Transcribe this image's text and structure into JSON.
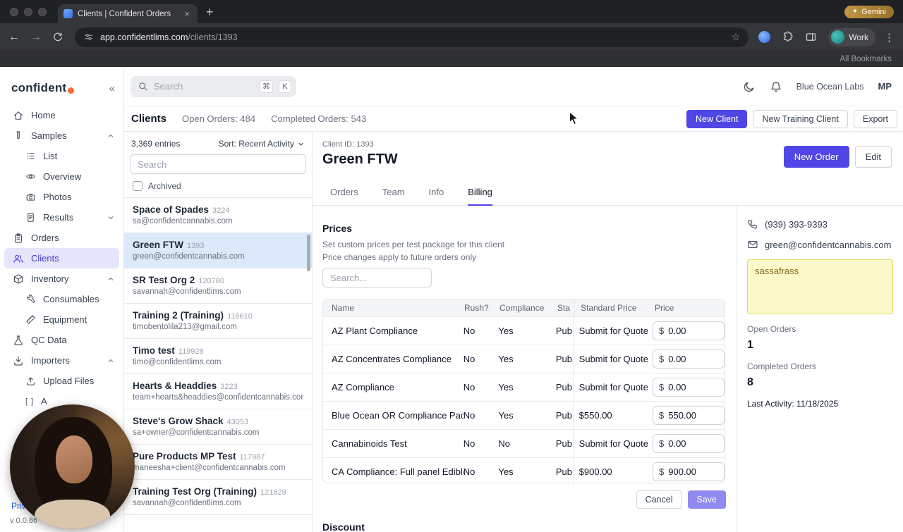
{
  "icons": {
    "back": "←",
    "forward": "→",
    "star": "☆",
    "menu": "⋮",
    "new_tab": "+",
    "close_tab": "×",
    "gemini_sparkle": "✦",
    "collapse": "«",
    "brackets": "[ ]"
  },
  "browser": {
    "tab_title": "Clients | Confident Orders",
    "gemini_label": "Gemini",
    "url_host": "app.confidentlims.com",
    "url_path": "/clients/1393",
    "profile_name": "Work",
    "all_bookmarks": "All Bookmarks"
  },
  "sidebar": {
    "logo_text": "confident",
    "nav": {
      "home": "Home",
      "samples": "Samples",
      "list": "List",
      "overview": "Overview",
      "photos": "Photos",
      "results": "Results",
      "orders": "Orders",
      "clients": "Clients",
      "inventory": "Inventory",
      "consumables": "Consumables",
      "equipment": "Equipment",
      "qc_data": "QC Data",
      "importers": "Importers",
      "upload_files": "Upload Files",
      "api": "A"
    },
    "privacy_link": "Priv",
    "version": "v 0.0.86"
  },
  "topbar": {
    "search_placeholder": "Search",
    "shortcut_cmd": "⌘",
    "shortcut_key": "K",
    "org_name": "Blue Ocean Labs",
    "user_initials": "MP"
  },
  "page_header": {
    "title": "Clients",
    "open_orders": "Open Orders: 484",
    "completed_orders": "Completed Orders: 543",
    "new_client_button": "New Client",
    "new_training_client_button": "New Training Client",
    "export_button": "Export"
  },
  "client_list": {
    "entries_count": "3,369 entries",
    "sort_label": "Sort: Recent Activity",
    "search_placeholder": "Search",
    "archived_label": "Archived",
    "items": [
      {
        "name": "Space of Spades",
        "id": "3224",
        "email": "sa@confidentcannabis.com"
      },
      {
        "name": "Green FTW",
        "id": "1393",
        "email": "green@confidentcannabis.com"
      },
      {
        "name": "SR Test Org 2",
        "id": "120780",
        "email": "savannah@confidentlims.com"
      },
      {
        "name": "Training 2 (Training)",
        "id": "116610",
        "email": "timobentolila213@gmail.com"
      },
      {
        "name": "Timo test",
        "id": "119928",
        "email": "timo@confidentlims.com"
      },
      {
        "name": "Hearts & Headdies",
        "id": "3223",
        "email": "team+hearts&headdies@confidentcannabis.com"
      },
      {
        "name": "Steve's Grow Shack",
        "id": "43053",
        "email": "sa+owner@confidentcannabis.com"
      },
      {
        "name": "Pure Products MP Test",
        "id": "117987",
        "email": "maneesha+client@confidentcannabis.com"
      },
      {
        "name": "Training Test Org (Training)",
        "id": "121629",
        "email": "savannah@confidentlims.com"
      }
    ]
  },
  "detail": {
    "client_id": "Client ID: 1393",
    "client_name": "Green FTW",
    "new_order_button": "New Order",
    "edit_button": "Edit",
    "tabs": [
      "Orders",
      "Team",
      "Info",
      "Billing"
    ],
    "active_tab": "Billing",
    "prices": {
      "title": "Prices",
      "description_line1": "Set custom prices per test package for this client",
      "description_line2": "Price changes apply to future orders only",
      "search_placeholder": "Search...",
      "currency_symbol": "$",
      "columns": {
        "name": "Name",
        "rush": "Rush?",
        "compliance": "Compliance",
        "status": "Sta",
        "standard_price": "Standard Price",
        "price": "Price"
      },
      "rows": [
        {
          "name": "AZ Plant Compliance",
          "rush": "No",
          "compliance": "Yes",
          "status": "Pub",
          "standard_price": "Submit for Quote",
          "price": "0.00"
        },
        {
          "name": "AZ Concentrates Compliance",
          "rush": "No",
          "compliance": "Yes",
          "status": "Pub",
          "standard_price": "Submit for Quote",
          "price": "0.00"
        },
        {
          "name": "AZ Compliance",
          "rush": "No",
          "compliance": "Yes",
          "status": "Pub",
          "standard_price": "Submit for Quote",
          "price": "0.00"
        },
        {
          "name": "Blue Ocean OR Compliance Package",
          "rush": "No",
          "compliance": "Yes",
          "status": "Pub",
          "standard_price": "$550.00",
          "price": "550.00"
        },
        {
          "name": "Cannabinoids Test",
          "rush": "No",
          "compliance": "No",
          "status": "Pub",
          "standard_price": "Submit for Quote",
          "price": "0.00"
        },
        {
          "name": "CA Compliance: Full panel Edibles",
          "rush": "No",
          "compliance": "Yes",
          "status": "Pub",
          "standard_price": "$900.00",
          "price": "900.00"
        }
      ],
      "cancel_button": "Cancel",
      "save_button": "Save"
    },
    "discount_title": "Discount"
  },
  "info_panel": {
    "phone": "(939) 393-9393",
    "email": "green@confidentcannabis.com",
    "note": "sassafrass",
    "open_orders_label": "Open Orders",
    "open_orders_value": "1",
    "completed_orders_label": "Completed Orders",
    "completed_orders_value": "8",
    "last_activity": "Last Activity: 11/18/2025"
  }
}
